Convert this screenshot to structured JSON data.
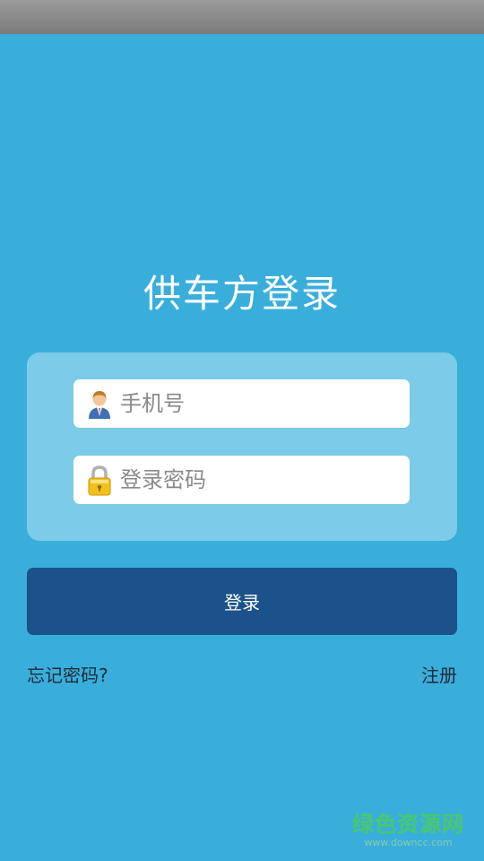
{
  "page": {
    "title": "供车方登录"
  },
  "form": {
    "phone": {
      "placeholder": "手机号",
      "value": "",
      "icon": "user-icon"
    },
    "password": {
      "placeholder": "登录密码",
      "value": "",
      "icon": "lock-icon"
    }
  },
  "actions": {
    "login_label": "登录",
    "forgot_label": "忘记密码?",
    "register_label": "注册"
  },
  "watermark": {
    "main": "绿色资源网",
    "sub": "www.downcc.com"
  },
  "colors": {
    "background": "#3aaedb",
    "panel": "#7ccbe8",
    "button": "#1b5289",
    "status_bar": "#8a8a8a"
  }
}
